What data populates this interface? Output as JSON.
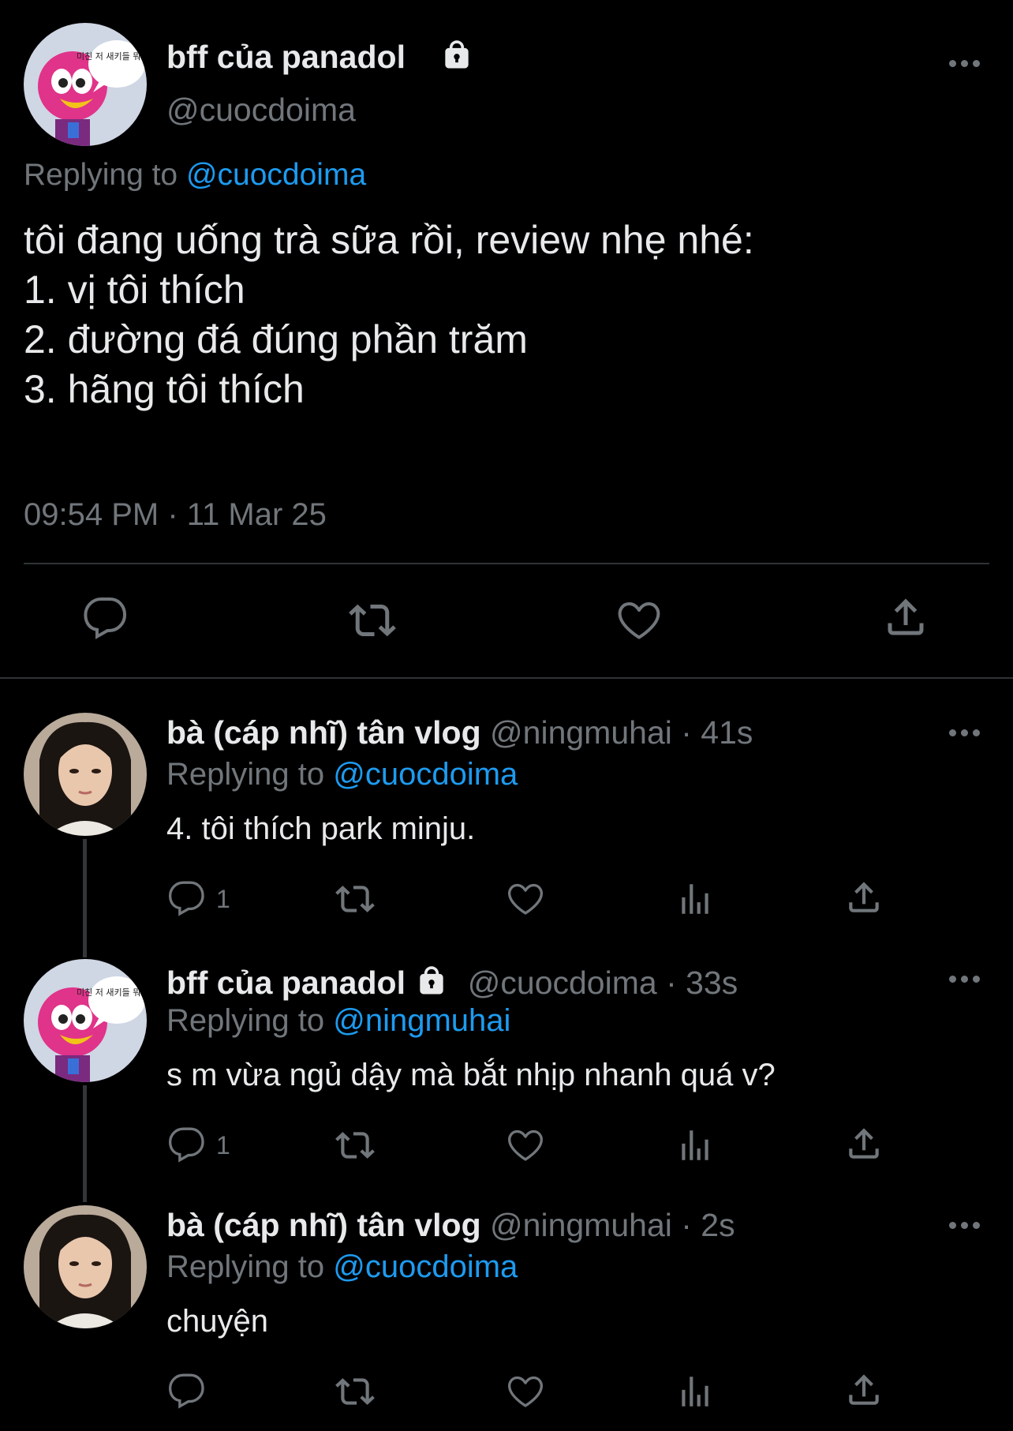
{
  "main_tweet": {
    "display_name": "bff của panadol",
    "handle": "@cuocdoima",
    "avatar_text": "미친 저 새키들 뭐해...",
    "replying_prefix": "Replying to ",
    "replying_to": "@cuocdoima",
    "lines": [
      "tôi đang uống trà sữa rồi, review nhẹ nhé:",
      "1. vị tôi thích",
      "2. đường đá đúng phần trăm",
      "3. hãng tôi thích"
    ],
    "timestamp": "09:54 PM · 11 Mar 25"
  },
  "replies": [
    {
      "display_name": "bà (cáp nhĩ) tân vlog",
      "handle_time": "@ningmuhai · 41s",
      "replying_prefix": "Replying to ",
      "replying_to": "@cuocdoima",
      "text": "4. tôi thích park minju.",
      "reply_count": "1"
    },
    {
      "display_name": "bff của panadol",
      "handle_time": "@cuocdoima · 33s",
      "replying_prefix": "Replying to ",
      "replying_to": "@ningmuhai",
      "text": "s m vừa ngủ dậy mà bắt nhịp nhanh quá v?",
      "reply_count": "1"
    },
    {
      "display_name": "bà (cáp nhĩ) tân vlog",
      "handle_time": "@ningmuhai · 2s",
      "replying_prefix": "Replying to ",
      "replying_to": "@cuocdoima",
      "text": "chuyện",
      "reply_count": ""
    }
  ],
  "colors": {
    "background": "#000000",
    "text": "#e7e9ea",
    "secondary": "#71767b",
    "accent": "#1d9bf0"
  },
  "icons": [
    "reply-icon",
    "retweet-icon",
    "like-icon",
    "share-icon",
    "views-icon",
    "more-icon",
    "lock-icon"
  ]
}
